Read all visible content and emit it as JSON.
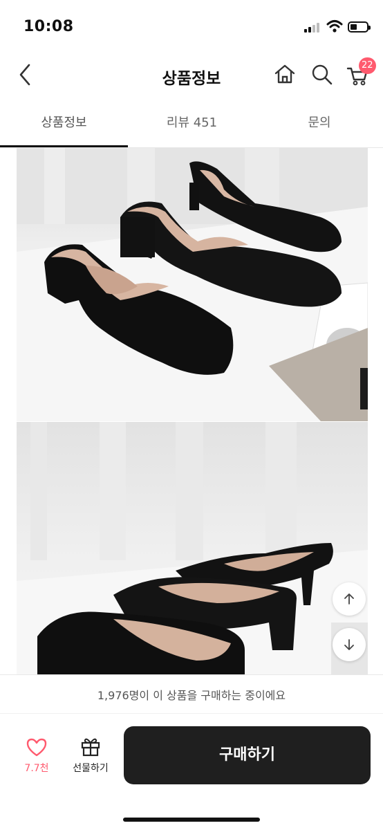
{
  "status_bar": {
    "time": "10:08"
  },
  "header": {
    "title": "상품정보",
    "cart_count": "22"
  },
  "tabs": [
    {
      "label": "상품정보",
      "active": true
    },
    {
      "label": "리뷰 451",
      "active": false
    },
    {
      "label": "문의",
      "active": false
    }
  ],
  "product_images": [
    {
      "subject": "black suede pointed mules, three shoes on white table with magazine"
    },
    {
      "subject": "black suede mules with block heels, side view"
    }
  ],
  "bottom_bar": {
    "buying_notice": "1,976명이 이 상품을 구매하는 중이에요",
    "like_count": "7.7천",
    "gift_label": "선물하기",
    "buy_label": "구매하기"
  },
  "colors": {
    "accent": "#ff5a6e",
    "buy_button": "#1f1f1f",
    "text": "#222222"
  },
  "icons": [
    "back-icon",
    "home-icon",
    "search-icon",
    "cart-icon",
    "heart-icon",
    "gift-icon",
    "arrow-up-icon",
    "arrow-down-icon"
  ]
}
